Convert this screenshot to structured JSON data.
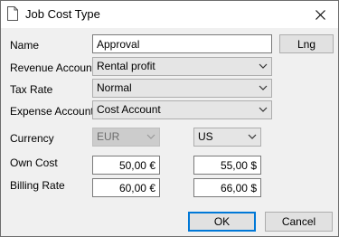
{
  "window": {
    "title": "Job Cost Type"
  },
  "icons": {
    "document": "document-icon",
    "close": "close-icon",
    "dropdown": "chevron-down-icon"
  },
  "form": {
    "name_label": "Name",
    "name_value": "Approval",
    "lng_button": "Lng",
    "revenue_label": "Revenue Account",
    "revenue_value": "Rental profit",
    "tax_label": "Tax Rate",
    "tax_value": "Normal",
    "expense_label": "Expense Account",
    "expense_value": "Cost Account",
    "currency_label": "Currency",
    "currency_primary": "EUR",
    "currency_secondary": "US",
    "own_cost_label": "Own Cost",
    "own_cost_primary": "50,00 €",
    "own_cost_secondary": "55,00 $",
    "billing_label": "Billing Rate",
    "billing_primary": "60,00 €",
    "billing_secondary": "66,00 $"
  },
  "buttons": {
    "ok": "OK",
    "cancel": "Cancel"
  },
  "colors": {
    "default_button_border": "#0078d7",
    "window_bg": "#f0f0f0"
  }
}
